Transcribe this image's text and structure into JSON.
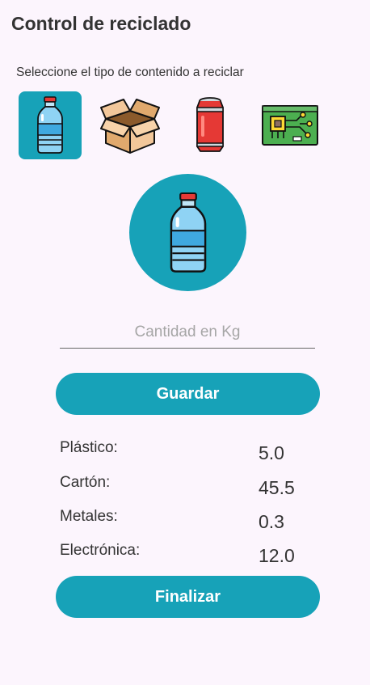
{
  "app": {
    "title": "Control de reciclado",
    "subtitle": "Seleccione el tipo de contenido a reciclar"
  },
  "types": [
    {
      "name": "plastic-bottle-icon",
      "selected": true
    },
    {
      "name": "cardboard-box-icon",
      "selected": false
    },
    {
      "name": "soda-can-icon",
      "selected": false
    },
    {
      "name": "circuit-board-icon",
      "selected": false
    }
  ],
  "preview": {
    "icon": "plastic-bottle-icon"
  },
  "form": {
    "quantity_placeholder": "Cantidad en Kg",
    "quantity_value": "",
    "save_label": "Guardar",
    "finish_label": "Finalizar"
  },
  "stats": [
    {
      "label": "Plástico:",
      "value": "5.0"
    },
    {
      "label": "Cartón:",
      "value": "45.5"
    },
    {
      "label": "Metales:",
      "value": "0.3"
    },
    {
      "label": "Electrónica:",
      "value": "12.0"
    }
  ],
  "colors": {
    "accent": "#17a2b8",
    "background": "#fcf5fd",
    "text": "#333333"
  }
}
